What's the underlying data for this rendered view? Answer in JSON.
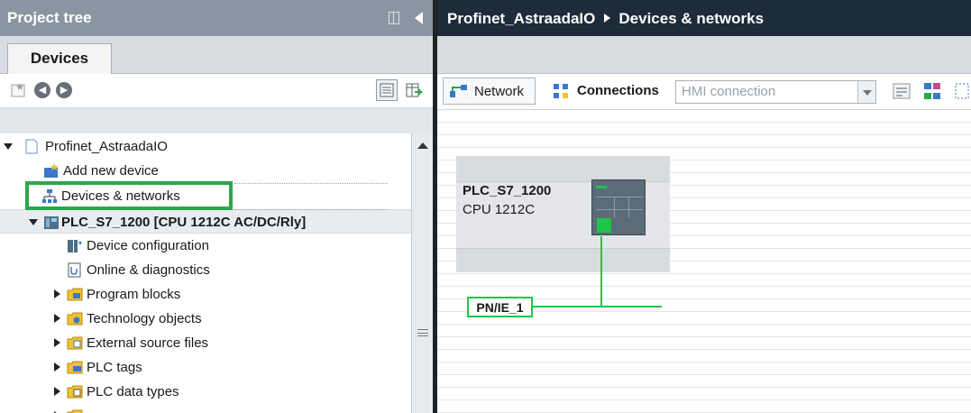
{
  "project_tree": {
    "title": "Project tree",
    "tab": "Devices",
    "items": [
      {
        "label": "Profinet_AstraadaIO",
        "icon": "project-icon",
        "expander": "expanded"
      },
      {
        "label": "Add new device",
        "icon": "add-device-icon",
        "expander": "none"
      },
      {
        "label": "Devices & networks",
        "icon": "network-icon",
        "expander": "none",
        "highlighted": true
      },
      {
        "label": "PLC_S7_1200 [CPU 1212C AC/DC/Rly]",
        "icon": "plc-icon",
        "expander": "expanded",
        "selected": true
      },
      {
        "label": "Device configuration",
        "icon": "device-config-icon",
        "expander": "none"
      },
      {
        "label": "Online & diagnostics",
        "icon": "diagnostics-icon",
        "expander": "none"
      },
      {
        "label": "Program blocks",
        "icon": "folder-icon",
        "expander": "collapsed"
      },
      {
        "label": "Technology objects",
        "icon": "folder-icon",
        "expander": "collapsed"
      },
      {
        "label": "External source files",
        "icon": "folder-icon",
        "expander": "collapsed"
      },
      {
        "label": "PLC tags",
        "icon": "folder-icon",
        "expander": "collapsed"
      },
      {
        "label": "PLC data types",
        "icon": "folder-icon",
        "expander": "collapsed"
      }
    ]
  },
  "editor": {
    "breadcrumb": [
      "Profinet_AstraadaIO",
      "Devices & networks"
    ],
    "toolbar": {
      "network_label": "Network",
      "connections_label": "Connections",
      "hmi_select_value": "HMI connection"
    },
    "device": {
      "name": "PLC_S7_1200",
      "type": "CPU 1212C"
    },
    "subnet_label": "PN/IE_1"
  },
  "colors": {
    "highlight": "#2aa84a",
    "subnet": "#1fc54a",
    "header_left": "#8996a2",
    "header_right": "#1d2b3a"
  }
}
